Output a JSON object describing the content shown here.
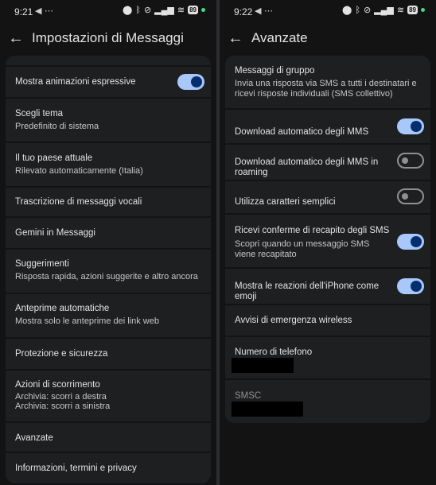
{
  "left": {
    "status": {
      "time": "9:21",
      "battery": "89"
    },
    "title": "Impostazioni di Messaggi",
    "items": [
      {
        "label": "Mostra animazioni espressive",
        "toggle": "on"
      },
      {
        "label": "Scegli tema",
        "sub": "Predefinito di sistema"
      },
      {
        "label": "Il tuo paese attuale",
        "sub": "Rilevato automaticamente (Italia)"
      },
      {
        "label": "Trascrizione di messaggi vocali"
      },
      {
        "label": "Gemini in Messaggi"
      },
      {
        "label": "Suggerimenti",
        "sub": "Risposta rapida, azioni suggerite e altro ancora"
      },
      {
        "label": "Anteprime automatiche",
        "sub": "Mostra solo le anteprime dei link web"
      },
      {
        "label": "Protezione e sicurezza"
      },
      {
        "label": "Azioni di scorrimento",
        "sub": "Archivia: scorri a destra",
        "sub2": "Archivia: scorri a sinistra"
      },
      {
        "label": "Avanzate"
      },
      {
        "label": "Informazioni, termini e privacy"
      }
    ]
  },
  "right": {
    "status": {
      "time": "9:22",
      "battery": "89"
    },
    "title": "Avanzate",
    "items": [
      {
        "label": "Messaggi di gruppo",
        "sub": "Invia una risposta via SMS a tutti i destinatari e",
        "sub2": "ricevi risposte individuali (SMS collettivo)"
      },
      {
        "label": "Download automatico degli MMS",
        "toggle": "on"
      },
      {
        "label": "Download automatico degli MMS in",
        "label2": "roaming",
        "toggle": "off"
      },
      {
        "label": "Utilizza caratteri semplici",
        "toggle": "off"
      },
      {
        "label": "Ricevi conferme di recapito degli SMS",
        "sub": "Scopri quando un messaggio SMS",
        "sub2": "viene recapitato",
        "toggle": "on"
      },
      {
        "label": "Mostra le reazioni dell'iPhone come",
        "label2": "emoji",
        "toggle": "on"
      },
      {
        "label": "Avvisi di emergenza wireless"
      },
      {
        "label": "Numero di telefono"
      },
      {
        "label": "SMSC"
      }
    ]
  },
  "icons": {
    "back": "arrow-back-icon",
    "telegram": "telegram-icon",
    "more": "more-icon",
    "location": "location-icon",
    "bluetooth": "bluetooth-icon",
    "silent": "vibrate-off-icon",
    "signal": "signal-icon",
    "wifi": "wifi-icon"
  }
}
